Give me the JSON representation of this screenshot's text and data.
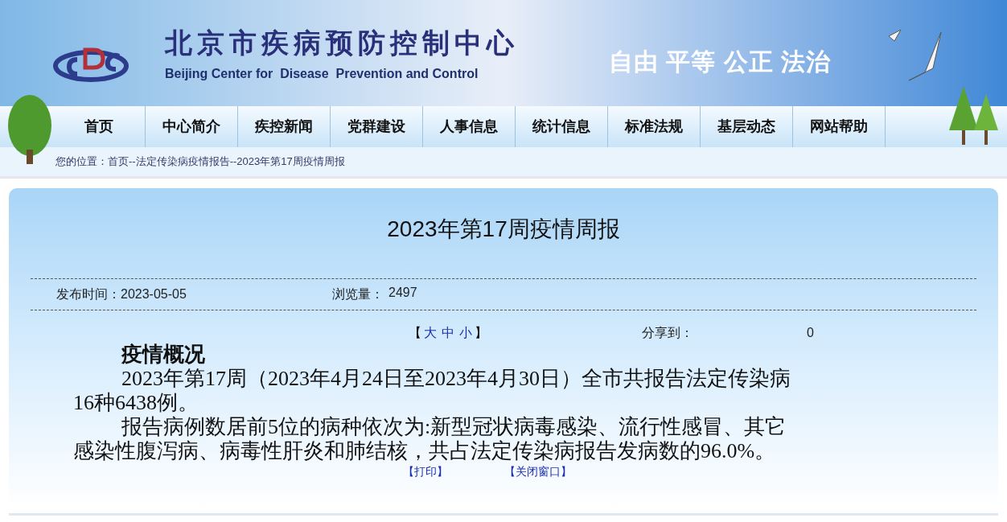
{
  "header": {
    "title": "北京市疾病预防控制中心",
    "subtitle": "Beijing Center for  Disease  Prevention and Control",
    "slogan": "自由 平等 公正 法治"
  },
  "nav": [
    {
      "label": "首页"
    },
    {
      "label": "中心简介"
    },
    {
      "label": "疾控新闻"
    },
    {
      "label": "党群建设"
    },
    {
      "label": "人事信息"
    },
    {
      "label": "统计信息"
    },
    {
      "label": "标准法规"
    },
    {
      "label": "基层动态"
    },
    {
      "label": "网站帮助"
    }
  ],
  "breadcrumb": "您的位置：首页--法定传染病疫情报告--2023年第17周疫情周报",
  "article": {
    "title": "2023年第17周疫情周报",
    "published": "发布时间：2023-05-05",
    "views_label": "浏览量：",
    "views": "2497",
    "font_size": {
      "open": "【",
      "sizes": [
        "大",
        "中",
        "小"
      ],
      "close": "】"
    },
    "share_label": "分享到：",
    "share_count": "0",
    "heading": "疫情概况",
    "paragraphs": [
      "2023年第17周（2023年4月24日至2023年4月30日）全市共报告法定传染病16种6438例。",
      "报告病例数居前5位的病种依次为:新型冠状病毒感染、流行性感冒、其它感染性腹泻病、病毒性肝炎和肺结核，共占法定传染病报告发病数的96.0%。"
    ],
    "actions": [
      "【打印】",
      "【关闭窗口】"
    ]
  }
}
